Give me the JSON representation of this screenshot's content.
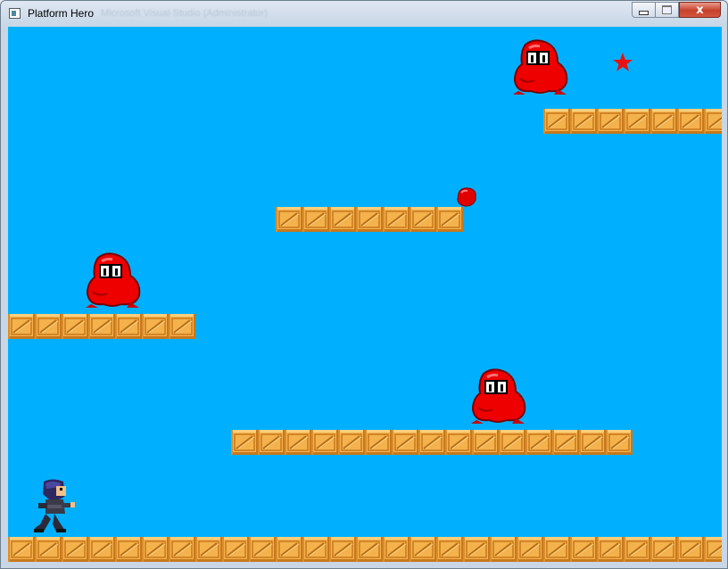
{
  "window": {
    "title": "Platform Hero",
    "background_title": "Microsoft Visual Studio (Administrator)",
    "controls": {
      "minimize": "minimize",
      "maximize": "maximize",
      "close": "x"
    }
  },
  "scene": {
    "sky_color": "#00b0ff",
    "crate_color": "#f4b24d",
    "crate_edge_color": "#c8781c",
    "enemy_color": "#ee0000",
    "platforms": [
      {
        "name": "top-right",
        "crates": 7
      },
      {
        "name": "middle",
        "crates": 7
      },
      {
        "name": "left",
        "crates": 7
      },
      {
        "name": "lower",
        "crates": 15
      },
      {
        "name": "ground",
        "crates": 27
      }
    ],
    "enemies": [
      "monster",
      "monster",
      "monster"
    ],
    "collectibles": [
      "gem"
    ],
    "powerups": [
      "star"
    ],
    "player": "ninja-hero"
  }
}
